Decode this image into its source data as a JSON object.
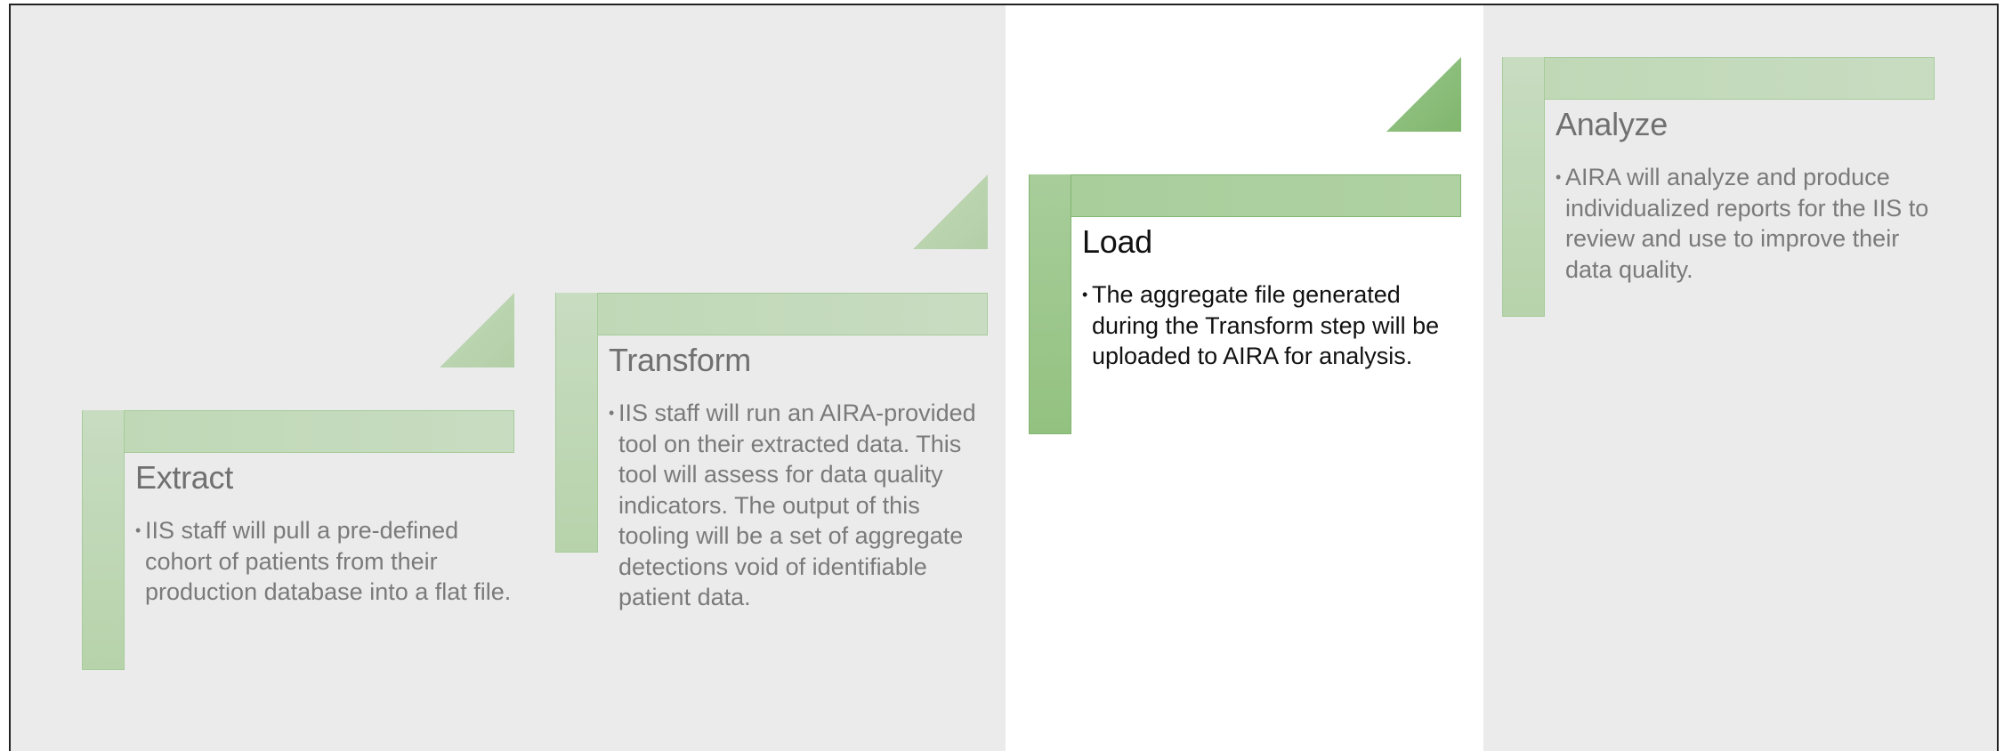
{
  "diagram": {
    "steps": [
      {
        "title": "Extract",
        "bullet": "•",
        "description": "IIS staff will pull a pre-defined cohort of patients from their production database into a flat file."
      },
      {
        "title": "Transform",
        "bullet": "•",
        "description": "IIS staff will run an AIRA-provided tool on their extracted data. This tool will assess for data quality indicators. The output of this tooling will be a set of aggregate detections void of identifiable patient data."
      },
      {
        "title": "Load",
        "bullet": "•",
        "description": "The aggregate file generated during the Transform step will be uploaded to AIRA for analysis."
      },
      {
        "title": "Analyze",
        "bullet": "•",
        "description": "AIRA will analyze and produce individualized reports for the IIS to review and use to improve their data quality."
      }
    ],
    "highlighted_step": "Load",
    "colors": {
      "dimmed_background": "#ebebeb",
      "highlight_background": "#ffffff",
      "dim_green": "#c3d9ba",
      "highlight_green": "#a8cd9b",
      "dim_text": "#7a7a7a",
      "highlight_text": "#111111"
    }
  }
}
